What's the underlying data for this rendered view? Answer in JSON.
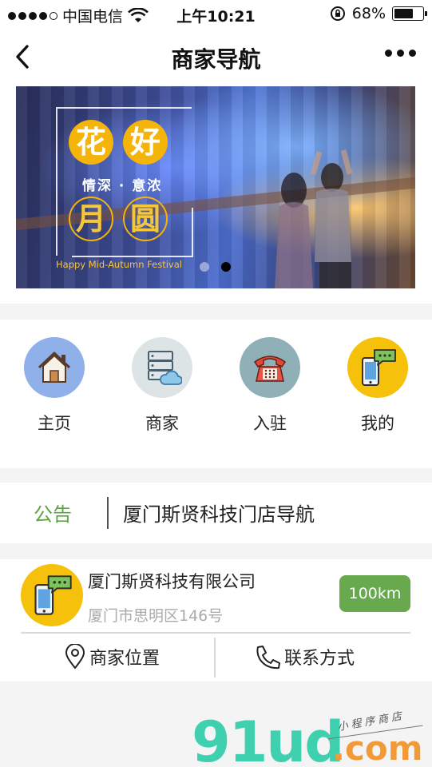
{
  "status_bar": {
    "carrier": "中国电信",
    "time": "上午10:21",
    "battery": "68%",
    "battery_level": 0.68,
    "signal_bars_filled": 4,
    "signal_bars_total": 5
  },
  "nav": {
    "title": "商家导航",
    "back_icon": "chevron-left-icon",
    "more_icon": "more-dots-icon"
  },
  "banner": {
    "chars": [
      "花",
      "好",
      "月",
      "圆"
    ],
    "subline": "情深 · 意浓",
    "festival": "Happy Mid-Autumn Festival",
    "slides_total": 2,
    "active_slide": 2
  },
  "menu": {
    "items": [
      {
        "label": "主页",
        "icon": "home-icon",
        "color": "#8fb0e9"
      },
      {
        "label": "商家",
        "icon": "server-cloud-icon",
        "color": "#dde4e6"
      },
      {
        "label": "入驻",
        "icon": "telephone-icon",
        "color": "#8fb0b6"
      },
      {
        "label": "我的",
        "icon": "phone-chat-icon",
        "color": "#f5c10a"
      }
    ]
  },
  "notice": {
    "tag": "公告",
    "text": "厦门斯贤科技门店导航"
  },
  "store": {
    "name": "厦门斯贤科技有限公司",
    "address": "厦门市思明区146号",
    "distance": "100km",
    "location_label": "商家位置",
    "contact_label": "联系方式"
  },
  "watermark": {
    "brand": "91ud",
    "suffix": ".com",
    "tagline": "小程序商店"
  },
  "colors": {
    "accent_green": "#67a94c",
    "notice_green": "#5aa543",
    "yellow": "#f5c10a"
  }
}
